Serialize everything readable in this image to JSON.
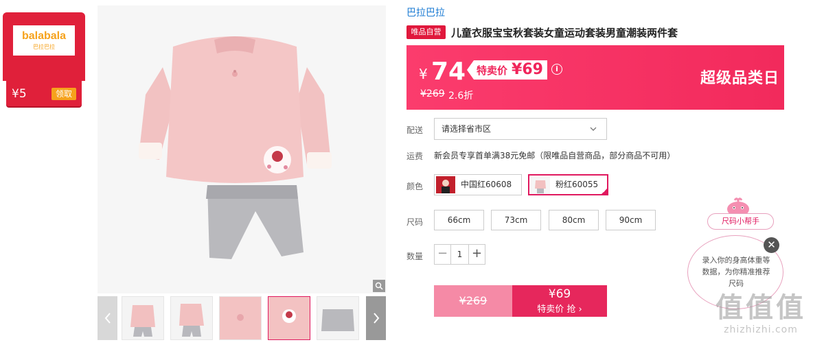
{
  "coupon": {
    "brand_logo": "balabala",
    "brand_logo_sub": "巴拉巴拉",
    "amount": "¥5",
    "claim_label": "领取"
  },
  "product": {
    "brand": "巴拉巴拉",
    "vip_tag": "唯品自营",
    "title": "儿童衣服宝宝秋套装女童运动套装男童潮装两件套"
  },
  "price": {
    "currency": "¥",
    "current": "74",
    "special_label": "特卖价",
    "special_amount": "¥69",
    "original": "¥269",
    "discount": "2.6折",
    "event_label": "超级品类日",
    "info_icon": "info-icon"
  },
  "delivery": {
    "label": "配送",
    "placeholder": "请选择省市区"
  },
  "shipping": {
    "label": "运费",
    "note": "新会员专享首单满38元免邮（限唯品自营商品，部分商品不可用）"
  },
  "color": {
    "label": "颜色",
    "options": [
      {
        "name": "中国红60608",
        "selected": false
      },
      {
        "name": "粉红60055",
        "selected": true
      }
    ]
  },
  "size": {
    "label": "尺码",
    "options": [
      "66cm",
      "73cm",
      "80cm",
      "90cm"
    ]
  },
  "quantity": {
    "label": "数量",
    "value": "1",
    "minus": "−",
    "plus": "+"
  },
  "buy": {
    "original_price": "¥269",
    "price": "¥69",
    "action_label": "特卖价 抢 ›"
  },
  "size_helper": {
    "title": "尺码小帮手",
    "text": "录入你的身高体重等数据，为你精准推荐尺码",
    "close": "✕"
  },
  "watermark": {
    "big": "值值值",
    "url": "zhizhizhi.com"
  },
  "colors": {
    "accent": "#f22a5c",
    "brand_blue": "#1b7bd3",
    "coupon_red": "#e0203a",
    "coupon_orange": "#f6a21c"
  }
}
